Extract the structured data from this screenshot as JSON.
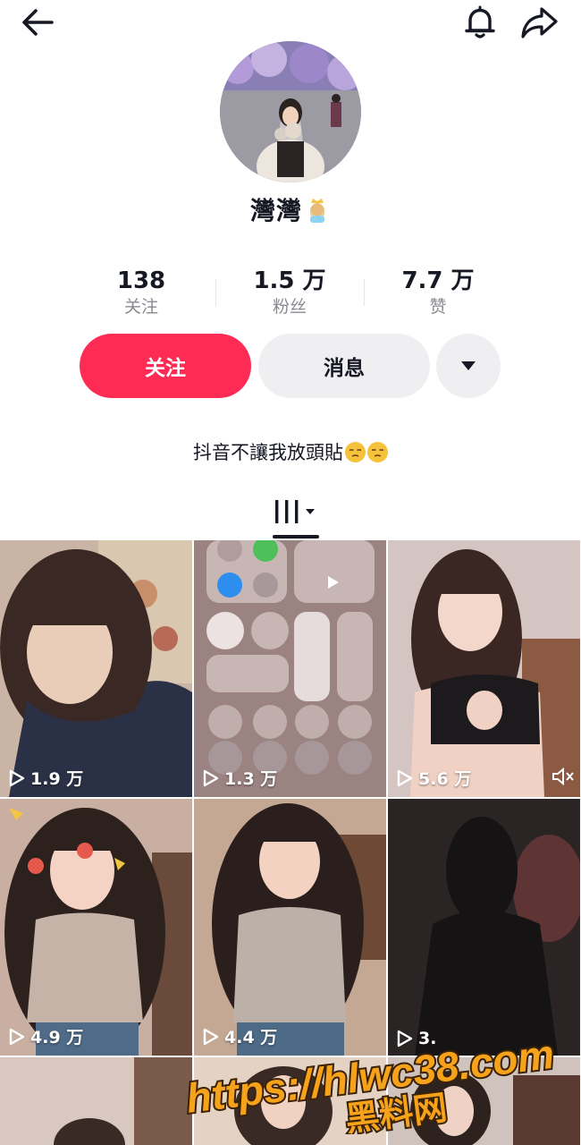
{
  "header": {
    "back_icon": "arrow-left-icon",
    "bell_icon": "bell-icon",
    "share_icon": "share-arrow-icon"
  },
  "profile": {
    "name": "灣灣",
    "name_emoji": "princess-emoji-icon",
    "bio": "抖音不讓我放頭貼",
    "bio_emoji": "unamused-face-emoji-icon"
  },
  "stats": [
    {
      "value": "138",
      "label": "关注"
    },
    {
      "value": "1.5 万",
      "label": "粉丝"
    },
    {
      "value": "7.7 万",
      "label": "赞"
    }
  ],
  "actions": {
    "follow_label": "关注",
    "message_label": "消息",
    "more_icon": "caret-down-icon"
  },
  "tabs": {
    "grid_icon": "grid-view-icon"
  },
  "videos": [
    {
      "views": "1.9 万"
    },
    {
      "views": "1.3 万"
    },
    {
      "views": "5.6 万",
      "muted_icon": "speaker-mute-icon"
    },
    {
      "views": "4.9 万"
    },
    {
      "views": "4.4 万"
    },
    {
      "views": "3."
    }
  ],
  "watermark": {
    "url": "https://hlwc38.com",
    "subtitle": "黑料网"
  },
  "colors": {
    "follow_button": "#fe2c55",
    "secondary_button": "#efeff1",
    "muted_text": "#8a8b91",
    "watermark_fill": "#f7a21b"
  }
}
